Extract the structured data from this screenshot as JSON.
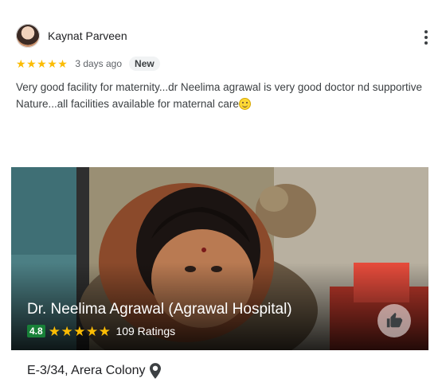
{
  "review": {
    "author_name": "Kaynat Parveen",
    "rating": 5,
    "star_glyph": "★",
    "time": "3 days ago",
    "badge": "New",
    "text": "Very good facility for maternity...dr Neelima agrawal is very good doctor nd supportive Nature...all facilities available for maternal care",
    "emoji_icon": "smiling-face-emoji"
  },
  "place": {
    "name": "Dr. Neelima Agrawal (Agrawal Hospital)",
    "rating_value": "4.8",
    "rating_stars": 5,
    "ratings_count": "109 Ratings",
    "address": "E-3/34, Arera Colony"
  },
  "icons": {
    "more": "more-vert-icon",
    "like": "thumb-up-icon",
    "location": "location-pin-icon"
  },
  "colors": {
    "star": "#fbbc04",
    "score_badge": "#188038",
    "badge_bg": "#f1f3f4"
  }
}
